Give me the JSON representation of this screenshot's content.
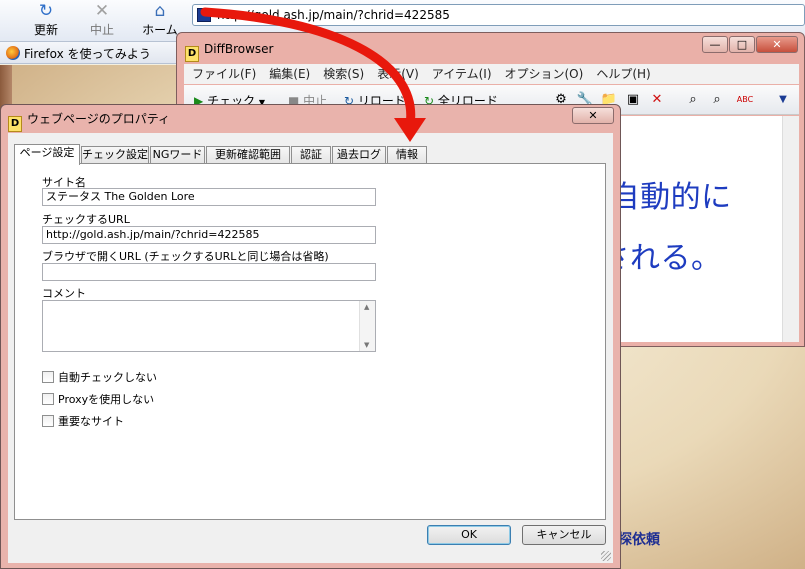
{
  "firefox": {
    "toolbar": {
      "reload_label": "更新",
      "stop_label": "中止",
      "home_label": "ホーム",
      "url": "http://gold.ash.jp/main/?chrid=422585"
    },
    "bookmark": "Firefox を使ってみよう",
    "page_text": "探依頼"
  },
  "diffbrowser": {
    "title": "DiffBrowser",
    "icon_letter": "D",
    "controls": {
      "minimize": "—",
      "maximize": "□",
      "close": "✕"
    },
    "menu": [
      "ファイル(F)",
      "編集(E)",
      "検索(S)",
      "表示(V)",
      "アイテム(I)",
      "オプション(O)",
      "ヘルプ(H)"
    ],
    "toolbar": {
      "check": "チェック",
      "stop": "中止",
      "reload": "リロード",
      "reload_all": "全リロード"
    }
  },
  "dialog": {
    "title": "ウェブページのプロパティ",
    "icon_letter": "D",
    "close": "✕",
    "tabs": [
      "ページ設定",
      "チェック設定",
      "NGワード",
      "更新確認範囲",
      "認証",
      "過去ログ",
      "情報"
    ],
    "fields": {
      "site_name_label": "サイト名",
      "site_name_value": "ステータス The Golden Lore",
      "check_url_label": "チェックするURL",
      "check_url_value": "http://gold.ash.jp/main/?chrid=422585",
      "browser_url_label": "ブラウザで開くURL (チェックするURLと同じ場合は省略)",
      "browser_url_value": "",
      "comment_label": "コメント",
      "comment_value": ""
    },
    "checkboxes": [
      "自動チェックしない",
      "Proxyを使用しない",
      "重要なサイト"
    ],
    "buttons": {
      "ok": "OK",
      "cancel": "キャンセル"
    }
  },
  "annotation": {
    "line1": "D&D操作で自動的に",
    "line2": "項目が登録される。",
    "color": "#1e3cc0"
  },
  "arrow": {
    "color": "#e8180c"
  }
}
